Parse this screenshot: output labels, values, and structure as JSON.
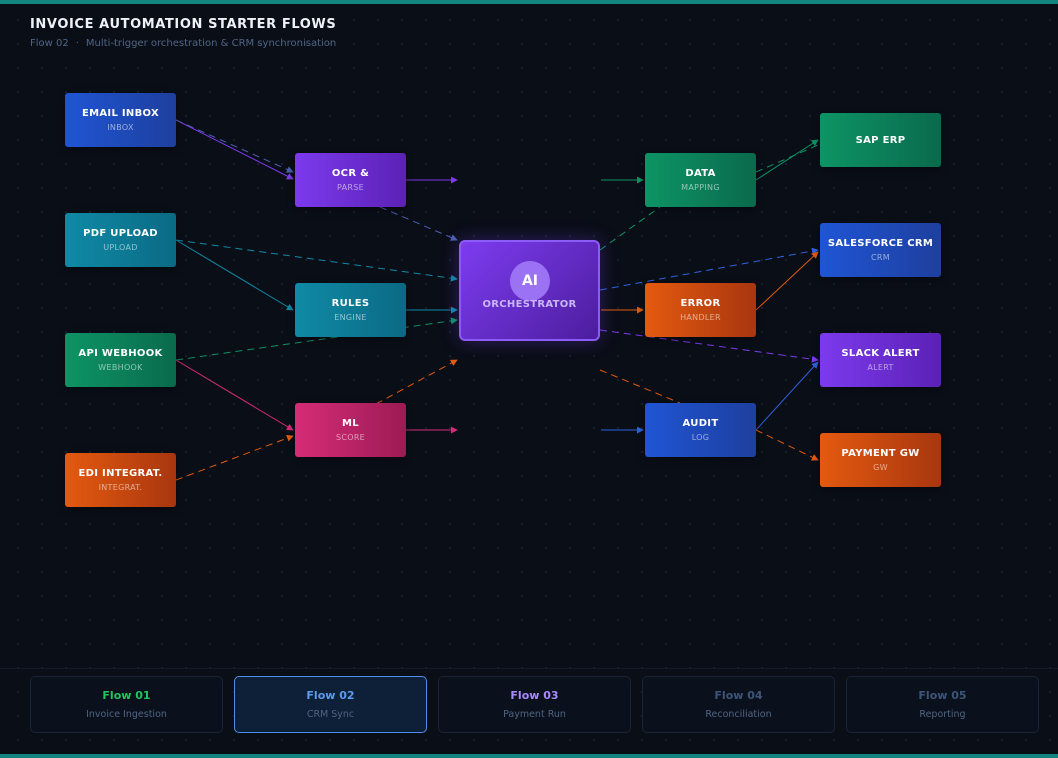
{
  "header": {
    "title": "INVOICE AUTOMATION STARTER FLOWS",
    "flow_id": "Flow 02",
    "separator": "·",
    "description": "Multi-trigger orchestration & CRM synchronisation"
  },
  "diagram": {
    "orchestrator": {
      "badge": "AI",
      "label": "ORCHESTRATOR",
      "sub": ""
    },
    "nodes": {
      "email_inbox": {
        "label": "EMAIL INBOX",
        "sub": "INBOX",
        "color": "#1f55d4"
      },
      "pdf_upload": {
        "label": "PDF UPLOAD",
        "sub": "UPLOAD",
        "color": "#0f8aa6"
      },
      "api_webhook": {
        "label": "API WEBHOOK",
        "sub": "WEBHOOK",
        "color": "#0d9465"
      },
      "edi_integrat": {
        "label": "EDI INTEGRAT.",
        "sub": "INTEGRAT.",
        "color": "#e45a0f"
      },
      "ocr": {
        "label": "OCR &",
        "sub": "PARSE",
        "color": "#7c3aed"
      },
      "rules": {
        "label": "RULES",
        "sub": "ENGINE",
        "color": "#0f8aa6"
      },
      "ml": {
        "label": "ML",
        "sub": "SCORE",
        "color": "#d62c77"
      },
      "data_mapping": {
        "label": "DATA",
        "sub": "MAPPING",
        "color": "#0d9465"
      },
      "error_handler": {
        "label": "ERROR",
        "sub": "HANDLER",
        "color": "#e45a0f"
      },
      "audit_log": {
        "label": "AUDIT",
        "sub": "LOG",
        "color": "#1f55d4"
      },
      "sap_erp": {
        "label": "SAP ERP",
        "sub": "",
        "color": "#0d9465"
      },
      "salesforce_crm": {
        "label": "SALESFORCE CRM",
        "sub": "CRM",
        "color": "#1f55d4"
      },
      "slack_alert": {
        "label": "SLACK ALERT",
        "sub": "ALERT",
        "color": "#7c3aed"
      },
      "payment_gw": {
        "label": "PAYMENT GW",
        "sub": "GW",
        "color": "#e45a0f"
      }
    },
    "edges": [
      {
        "from": "email_inbox",
        "to": "ocr",
        "style": "solid",
        "color": "#7c3aed"
      },
      {
        "from": "email_inbox",
        "to": "ocr",
        "style": "dashed",
        "color": "#4b5fb0"
      },
      {
        "from": "pdf_upload",
        "to": "rules",
        "style": "solid",
        "color": "#0f8aa6"
      },
      {
        "from": "pdf_upload",
        "to": "orchestrator",
        "style": "dashed",
        "color": "#0f8aa6"
      },
      {
        "from": "api_webhook",
        "to": "ml",
        "style": "solid",
        "color": "#d62c77"
      },
      {
        "from": "api_webhook",
        "to": "orchestrator",
        "style": "dashed",
        "color": "#0d9465"
      },
      {
        "from": "edi_integrat",
        "to": "ml",
        "style": "dashed",
        "color": "#e45a0f"
      },
      {
        "from": "ml",
        "to": "orchestrator",
        "style": "dashed",
        "color": "#e45a0f"
      },
      {
        "from": "ocr",
        "to": "orchestrator",
        "style": "solid",
        "color": "#7c3aed"
      },
      {
        "from": "ocr",
        "to": "orchestrator",
        "style": "dashed",
        "color": "#4b5fb0"
      },
      {
        "from": "rules",
        "to": "orchestrator",
        "style": "solid",
        "color": "#0f8aa6"
      },
      {
        "from": "ml",
        "to": "orchestrator",
        "style": "solid",
        "color": "#d62c77"
      },
      {
        "from": "orchestrator",
        "to": "data_mapping",
        "style": "solid",
        "color": "#0d9465"
      },
      {
        "from": "orchestrator",
        "to": "data_mapping",
        "style": "dashed",
        "color": "#0d9465"
      },
      {
        "from": "orchestrator",
        "to": "error_handler",
        "style": "solid",
        "color": "#e45a0f"
      },
      {
        "from": "orchestrator",
        "to": "audit_log",
        "style": "solid",
        "color": "#1f55d4"
      },
      {
        "from": "orchestrator",
        "to": "audit_log",
        "style": "dashed",
        "color": "#e45a0f"
      },
      {
        "from": "orchestrator",
        "to": "salesforce_crm",
        "style": "dashed",
        "color": "#1f55d4"
      },
      {
        "from": "orchestrator",
        "to": "slack_alert",
        "style": "dashed",
        "color": "#7c3aed"
      },
      {
        "from": "data_mapping",
        "to": "sap_erp",
        "style": "solid",
        "color": "#0d9465"
      },
      {
        "from": "data_mapping",
        "to": "sap_erp",
        "style": "dashed",
        "color": "#0d9465"
      },
      {
        "from": "error_handler",
        "to": "salesforce_crm",
        "style": "solid",
        "color": "#e45a0f"
      },
      {
        "from": "audit_log",
        "to": "slack_alert",
        "style": "solid",
        "color": "#1f55d4"
      },
      {
        "from": "audit_log",
        "to": "payment_gw",
        "style": "dashed",
        "color": "#e45a0f"
      }
    ]
  },
  "footer": {
    "tabs": [
      {
        "label": "Flow 01",
        "sub": "Invoice Ingestion",
        "color": "#22c55e",
        "active": false
      },
      {
        "label": "Flow 02",
        "sub": "CRM Sync",
        "color": "#5b9cf0",
        "active": true
      },
      {
        "label": "Flow 03",
        "sub": "Payment Run",
        "color": "#a78bfa",
        "active": false
      },
      {
        "label": "Flow 04",
        "sub": "Reconciliation",
        "color": "#3d5578",
        "active": false
      },
      {
        "label": "Flow 05",
        "sub": "Reporting",
        "color": "#3d5578",
        "active": false
      }
    ]
  }
}
